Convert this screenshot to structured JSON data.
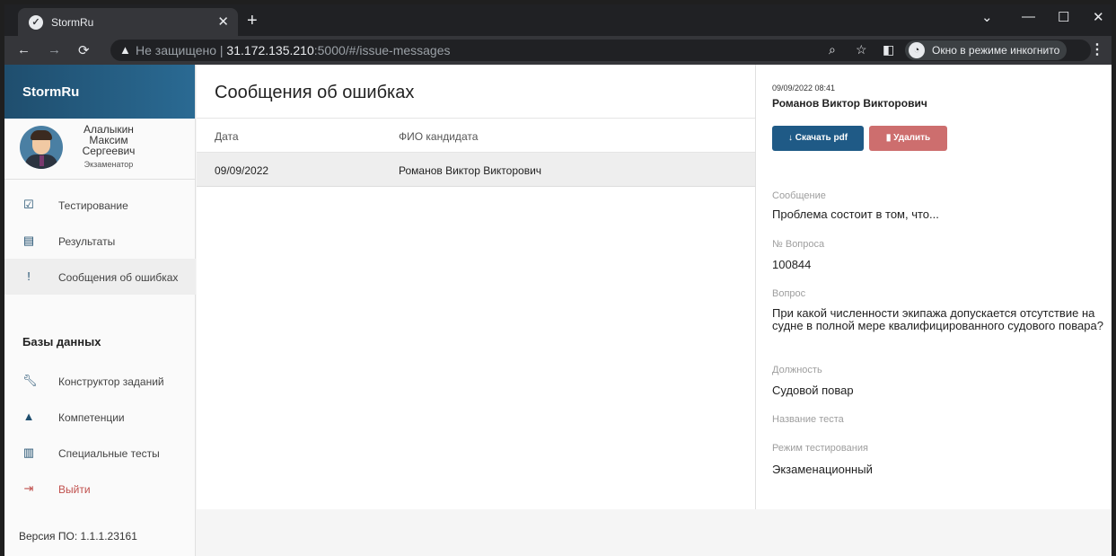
{
  "browser": {
    "tab_title": "StormRu",
    "url_warning": "Не защищено",
    "url_host": "31.172.135.210",
    "url_rest": ":5000/#/issue-messages",
    "incognito_label": "Окно в режиме инкогнито"
  },
  "sidebar": {
    "brand": "StormRu",
    "user_name_line1": "Алалыкин",
    "user_name_line2": "Максим",
    "user_name_line3": "Сергеевич",
    "user_role": "Экзаменатор",
    "items": [
      {
        "label": "Тестирование",
        "icon": "check-box-icon"
      },
      {
        "label": "Результаты",
        "icon": "clipboard-icon"
      },
      {
        "label": "Сообщения об ошибках",
        "icon": "feedback-icon",
        "active": true
      }
    ],
    "section_title": "Базы данных",
    "db_items": [
      {
        "label": "Конструктор заданий",
        "icon": "wrench-icon"
      },
      {
        "label": "Компетенции",
        "icon": "graduation-cap-icon"
      },
      {
        "label": "Специальные тесты",
        "icon": "table-icon"
      }
    ],
    "logout_label": "Выйти",
    "version": "Версия ПО: 1.1.1.23161",
    "logout_color": "#c0504d",
    "accent": "#1f4e6e"
  },
  "main": {
    "title": "Сообщения об ошибках",
    "columns": [
      "Дата",
      "ФИО кандидата"
    ],
    "rows": [
      {
        "date": "09/09/2022",
        "name": "Романов Виктор Викторович"
      }
    ]
  },
  "detail": {
    "datetime": "09/09/2022 08:41",
    "name": "Романов Виктор Викторович",
    "download_label": "Скачать pdf",
    "delete_label": "Удалить",
    "message_label": "Сообщение",
    "message_value": "Проблема состоит в том, что...",
    "qnum_label": "№ Вопроса",
    "qnum_value": "100844",
    "question_label": "Вопрос",
    "question_value": "При какой численности экипажа допускается отсутствие на судне в полной мере квалифицированного судового повара?",
    "position_label": "Должность",
    "position_value": "Судовой повар",
    "test_name_label": "Название теста",
    "mode_label": "Режим тестирования",
    "mode_value": "Экзаменационный"
  }
}
